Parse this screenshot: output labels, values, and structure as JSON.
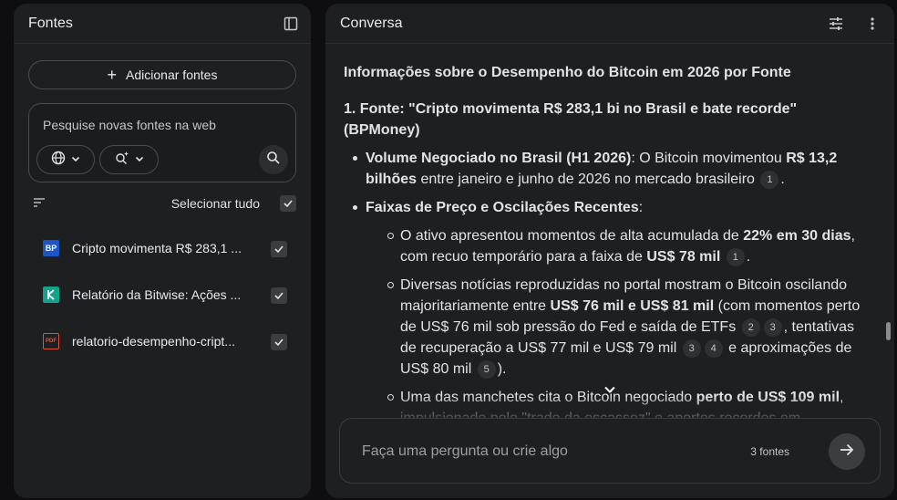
{
  "sources_panel": {
    "title": "Fontes",
    "add_sources_label": "Adicionar fontes",
    "search_placeholder": "Pesquise novas fontes na web",
    "select_all_label": "Selecionar tudo",
    "items": [
      {
        "title": "Cripto movimenta R$ 283,1 ...",
        "icon": "bp-logo",
        "checked": true
      },
      {
        "title": "Relatório da Bitwise: Ações ...",
        "icon": "bitwise-logo",
        "checked": true
      },
      {
        "title": "relatorio-desempenho-cript...",
        "icon": "pdf-icon",
        "checked": true
      }
    ]
  },
  "chat_panel": {
    "title": "Conversa",
    "heading": "Informações sobre o Desempenho do Bitcoin em 2026 por Fonte",
    "section1": {
      "title_line": "1. Fonte: \"Cripto movimenta R$ 283,1 bi no Brasil e bate recorde\" (BPMoney)",
      "bullet1": {
        "label": "Volume Negociado no Brasil (H1 2026)",
        "text_a": ": O Bitcoin movimentou ",
        "bold": "R$ 13,2 bilhões",
        "text_b": " entre janeiro e junho de 2026 no mercado brasileiro",
        "cite": "1"
      },
      "bullet2": {
        "label": "Faixas de Preço e Oscilações Recentes",
        "colon": ":",
        "sub1": {
          "text_a": "O ativo apresentou momentos de alta acumulada de ",
          "bold_a": "22% em 30 dias",
          "text_b": ", com recuo temporário para a faixa de ",
          "bold_b": "US$ 78 mil",
          "cite": "1",
          "end": "."
        },
        "sub2": {
          "text_a": "Diversas notícias reproduzidas no portal mostram o Bitcoin oscilando majoritariamente entre ",
          "bold_a": "US$ 76 mil e US$ 81 mil",
          "text_b": " (com momentos perto de US$ 76 mil sob pressão do Fed e saída de ETFs",
          "cite_a": "2",
          "cite_b": "3",
          "text_c": ", tentativas de recuperação a US$ 77 mil e US$ 79 mil",
          "cite_c": "3",
          "cite_d": "4",
          "text_d": " e aproximações de US$ 80 mil",
          "cite_e": "5",
          "end": ")."
        },
        "sub3": {
          "text_a": "Uma das manchetes cita o Bitcoin negociado ",
          "bold_a": "perto de US$ 109 mil",
          "text_b": ", impulsionado pelo \"trade da escassez\" e aportes recordes em"
        }
      }
    },
    "composer": {
      "placeholder": "Faça uma pergunta ou crie algo",
      "source_count": "3 fontes"
    }
  }
}
